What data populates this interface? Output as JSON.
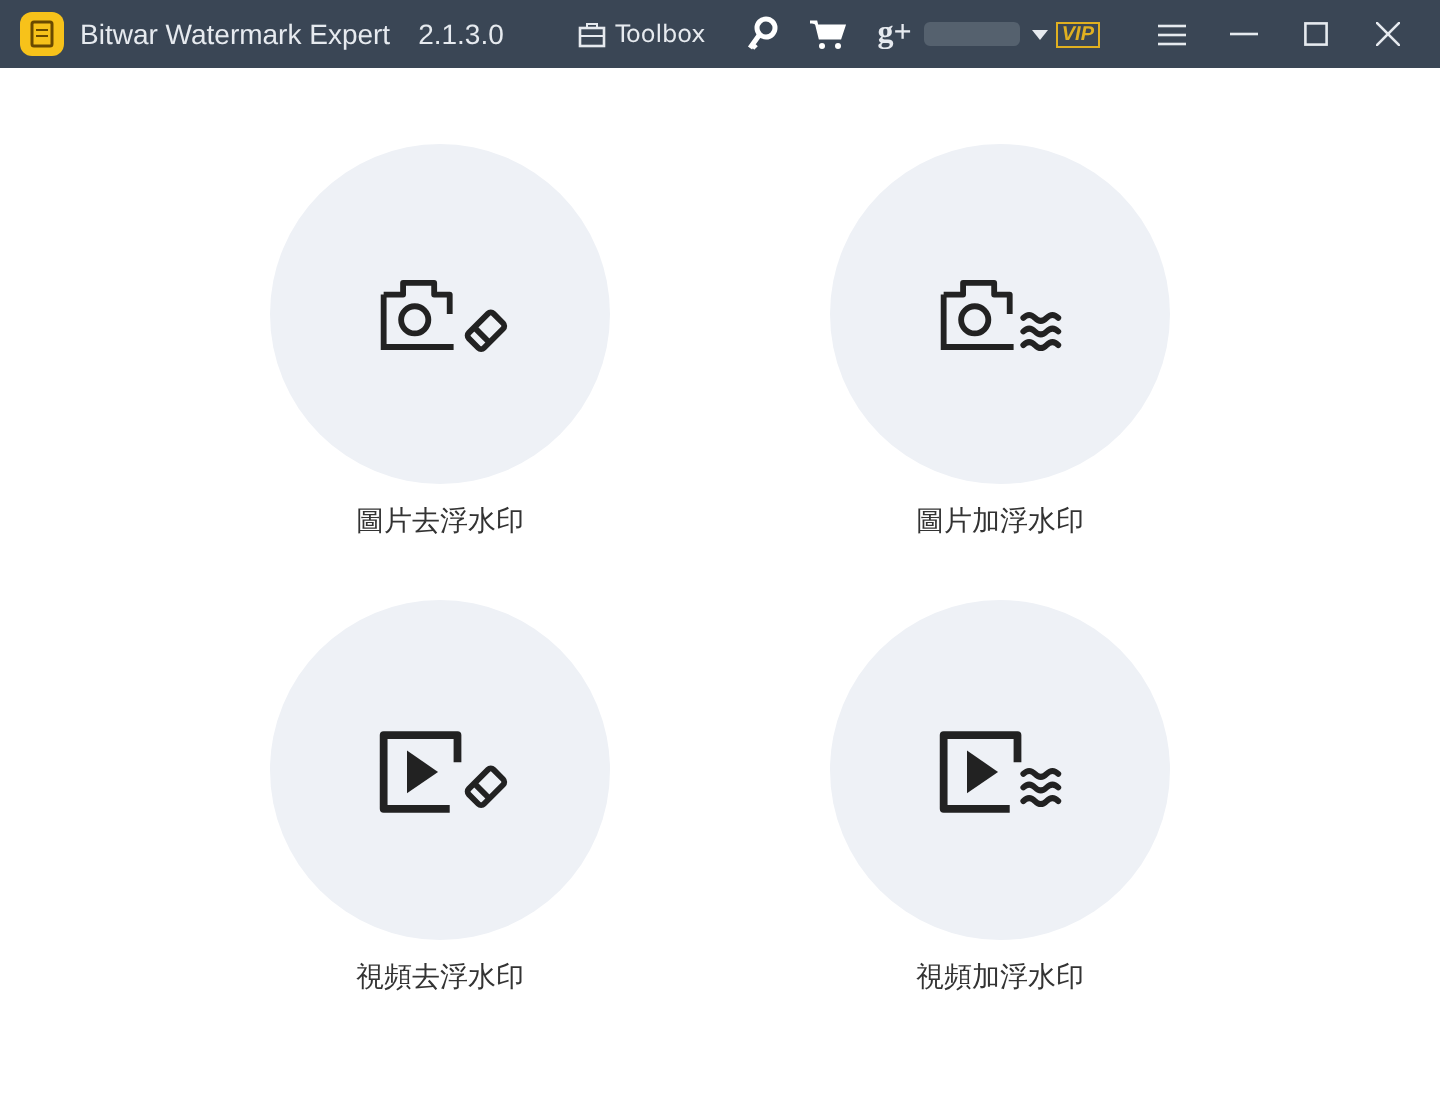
{
  "window": {
    "title": "Bitwar Watermark Expert",
    "version": "2.1.3.0"
  },
  "toolbar": {
    "toolbox_label": "Toolbox",
    "social_label": "g+",
    "vip_badge": "VIP"
  },
  "tiles": [
    {
      "label": "圖片去浮水印",
      "kind": "image_remove"
    },
    {
      "label": "圖片加浮水印",
      "kind": "image_add"
    },
    {
      "label": "視頻去浮水印",
      "kind": "video_remove"
    },
    {
      "label": "視頻加浮水印",
      "kind": "video_add"
    }
  ]
}
